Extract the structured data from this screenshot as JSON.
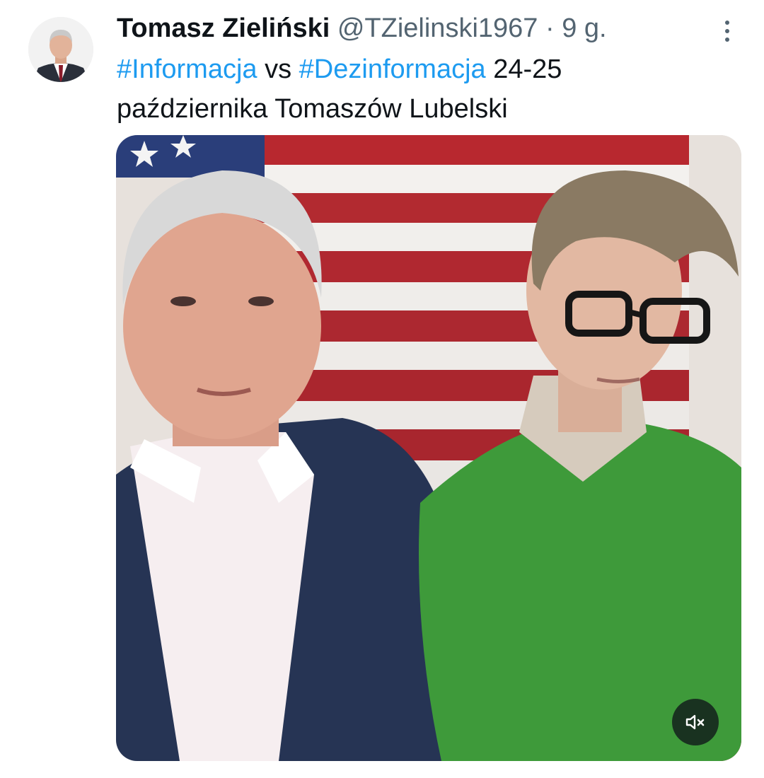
{
  "tweet": {
    "author": {
      "display_name": "Tomasz Zieliński",
      "handle": "@TZielinski1967",
      "separator": "·",
      "time": "9 g."
    },
    "text": {
      "hashtag_1": "#Informacja",
      "word_vs": "vs",
      "hashtag_2": "#Dezinformacja",
      "rest_line": "24-25",
      "line_2": "października Tomaszów Lubelski"
    },
    "media": {
      "type": "video",
      "mute_icon": "speaker-muted-icon"
    },
    "more_icon": "more-vertical-icon"
  },
  "colors": {
    "text_primary": "#0f1419",
    "text_secondary": "#536471",
    "link": "#1d9bf0",
    "background": "#ffffff"
  }
}
